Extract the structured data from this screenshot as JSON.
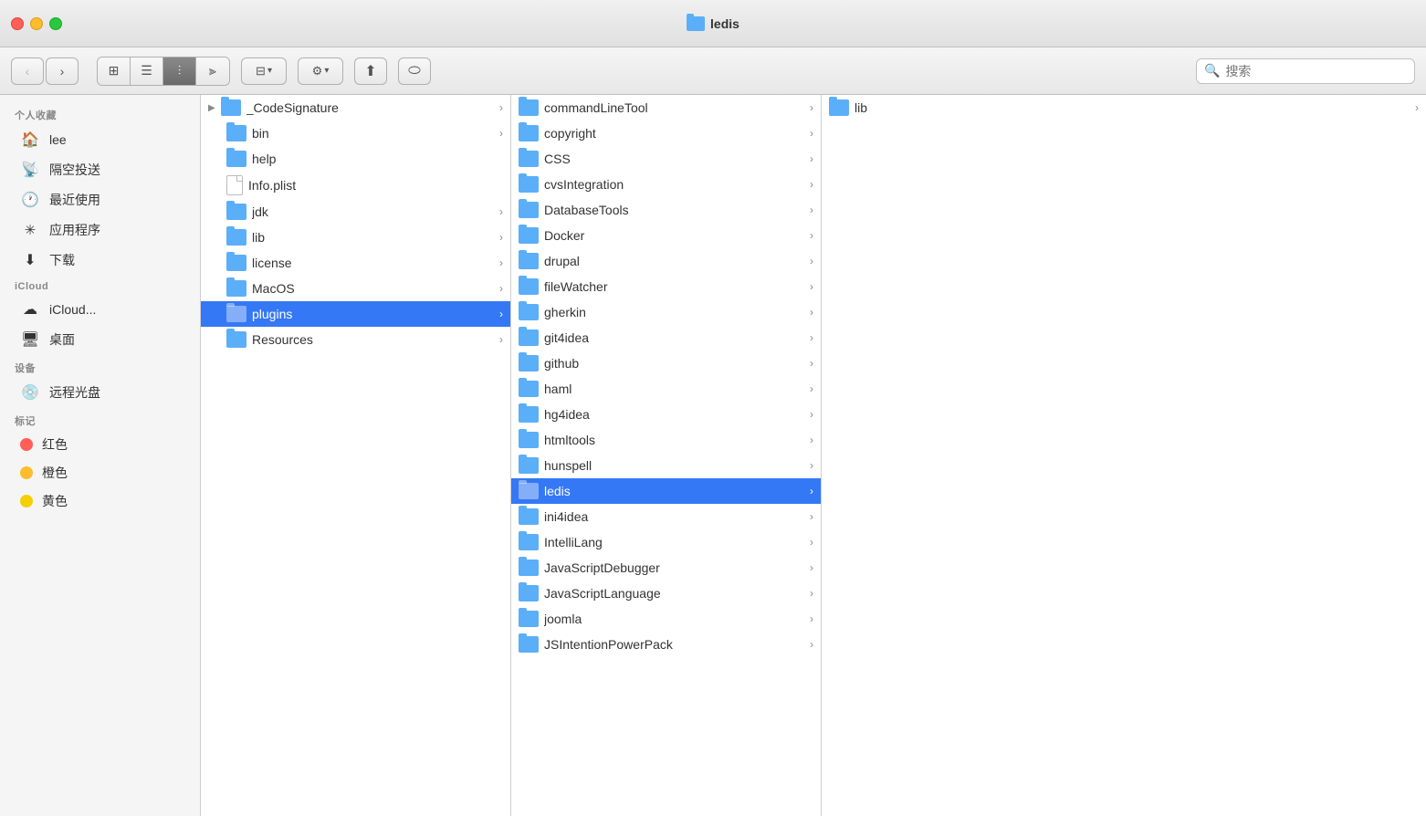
{
  "titlebar": {
    "title": "ledis"
  },
  "toolbar": {
    "back_label": "‹",
    "forward_label": "›",
    "view_icon_label": "⊞",
    "view_list_label": "☰",
    "view_column_label": "⫶",
    "view_gallery_label": "⫸",
    "view_arrange_label": "⊟",
    "settings_label": "⚙",
    "share_label": "⬆",
    "tag_label": "⬭",
    "search_placeholder": "搜索"
  },
  "sidebar": {
    "favorites_label": "个人收藏",
    "favorites": [
      {
        "id": "lee",
        "label": "lee",
        "icon": "🏠"
      },
      {
        "id": "airdrop",
        "label": "隔空投送",
        "icon": "📡"
      },
      {
        "id": "recent",
        "label": "最近使用",
        "icon": "🕐"
      },
      {
        "id": "applications",
        "label": "应用程序",
        "icon": "🅰"
      },
      {
        "id": "downloads",
        "label": "下载",
        "icon": "⬇"
      }
    ],
    "icloud_label": "iCloud",
    "icloud": [
      {
        "id": "icloud-drive",
        "label": "iCloud...",
        "icon": "☁"
      },
      {
        "id": "desktop",
        "label": "桌面",
        "icon": "🖥"
      }
    ],
    "devices_label": "设备",
    "devices": [
      {
        "id": "remote-disk",
        "label": "远程光盘",
        "icon": "💿"
      }
    ],
    "tags_label": "标记",
    "tags": [
      {
        "id": "red",
        "label": "红色",
        "color": "#ff5f57"
      },
      {
        "id": "orange",
        "label": "橙色",
        "color": "#febc2e"
      },
      {
        "id": "yellow",
        "label": "黄色",
        "color": "#f5d000"
      }
    ]
  },
  "columns": {
    "col1": {
      "items": [
        {
          "label": "_CodeSignature",
          "type": "folder",
          "hasChildren": true,
          "selected": false
        },
        {
          "label": "bin",
          "type": "folder",
          "hasChildren": true,
          "selected": false
        },
        {
          "label": "help",
          "type": "folder",
          "hasChildren": false,
          "selected": false
        },
        {
          "label": "Info.plist",
          "type": "file",
          "hasChildren": false,
          "selected": false
        },
        {
          "label": "jdk",
          "type": "folder",
          "hasChildren": true,
          "selected": false
        },
        {
          "label": "lib",
          "type": "folder",
          "hasChildren": true,
          "selected": false
        },
        {
          "label": "license",
          "type": "folder",
          "hasChildren": true,
          "selected": false
        },
        {
          "label": "MacOS",
          "type": "folder",
          "hasChildren": true,
          "selected": false
        },
        {
          "label": "plugins",
          "type": "folder",
          "hasChildren": true,
          "selected": true
        },
        {
          "label": "Resources",
          "type": "folder",
          "hasChildren": true,
          "selected": false
        }
      ]
    },
    "col2": {
      "items": [
        {
          "label": "commandLineTool",
          "type": "folder",
          "hasChildren": true,
          "selected": false
        },
        {
          "label": "copyright",
          "type": "folder",
          "hasChildren": true,
          "selected": false
        },
        {
          "label": "CSS",
          "type": "folder",
          "hasChildren": true,
          "selected": false
        },
        {
          "label": "cvsIntegration",
          "type": "folder",
          "hasChildren": true,
          "selected": false
        },
        {
          "label": "DatabaseTools",
          "type": "folder",
          "hasChildren": true,
          "selected": false
        },
        {
          "label": "Docker",
          "type": "folder",
          "hasChildren": true,
          "selected": false
        },
        {
          "label": "drupal",
          "type": "folder",
          "hasChildren": true,
          "selected": false
        },
        {
          "label": "fileWatcher",
          "type": "folder",
          "hasChildren": true,
          "selected": false
        },
        {
          "label": "gherkin",
          "type": "folder",
          "hasChildren": true,
          "selected": false
        },
        {
          "label": "git4idea",
          "type": "folder",
          "hasChildren": true,
          "selected": false
        },
        {
          "label": "github",
          "type": "folder",
          "hasChildren": true,
          "selected": false
        },
        {
          "label": "haml",
          "type": "folder",
          "hasChildren": true,
          "selected": false
        },
        {
          "label": "hg4idea",
          "type": "folder",
          "hasChildren": true,
          "selected": false
        },
        {
          "label": "htmltools",
          "type": "folder",
          "hasChildren": true,
          "selected": false
        },
        {
          "label": "hunspell",
          "type": "folder",
          "hasChildren": true,
          "selected": false
        },
        {
          "label": "ledis",
          "type": "folder",
          "hasChildren": true,
          "selected": true
        },
        {
          "label": "ini4idea",
          "type": "folder",
          "hasChildren": true,
          "selected": false
        },
        {
          "label": "IntelliLang",
          "type": "folder",
          "hasChildren": true,
          "selected": false
        },
        {
          "label": "JavaScriptDebugger",
          "type": "folder",
          "hasChildren": true,
          "selected": false
        },
        {
          "label": "JavaScriptLanguage",
          "type": "folder",
          "hasChildren": true,
          "selected": false
        },
        {
          "label": "joomla",
          "type": "folder",
          "hasChildren": true,
          "selected": false
        },
        {
          "label": "JSIntentionPowerPack",
          "type": "folder",
          "hasChildren": true,
          "selected": false
        }
      ]
    },
    "col3": {
      "items": [
        {
          "label": "lib",
          "type": "folder",
          "hasChildren": true,
          "selected": false
        }
      ]
    }
  }
}
